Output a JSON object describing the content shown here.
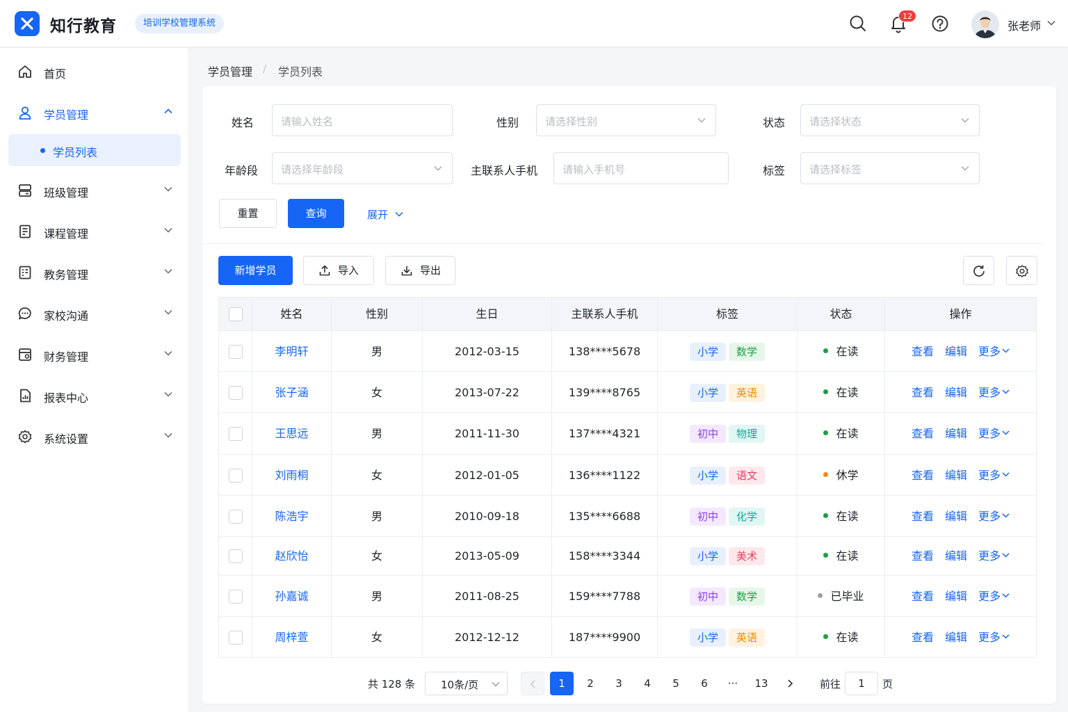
{
  "header": {
    "brand": "知行教育",
    "system_tag": "培训学校管理系统",
    "notification_count": "12",
    "user_name": "张老师"
  },
  "sidebar": {
    "items": [
      {
        "label": "首页",
        "icon": "home-icon"
      },
      {
        "label": "学员管理",
        "icon": "user-icon",
        "expanded": true
      },
      {
        "label": "班级管理",
        "icon": "class-icon"
      },
      {
        "label": "课程管理",
        "icon": "course-icon"
      },
      {
        "label": "教务管理",
        "icon": "academic-icon"
      },
      {
        "label": "家校沟通",
        "icon": "chat-icon"
      },
      {
        "label": "财务管理",
        "icon": "finance-icon"
      },
      {
        "label": "报表中心",
        "icon": "report-icon"
      },
      {
        "label": "系统设置",
        "icon": "gear-icon"
      }
    ],
    "sub_item": "学员列表"
  },
  "breadcrumb": [
    "学员管理",
    "学员列表"
  ],
  "filters": {
    "name_label": "姓名",
    "name_placeholder": "请输入姓名",
    "gender_label": "性别",
    "gender_placeholder": "请选择性别",
    "status_label": "状态",
    "status_placeholder": "请选择状态",
    "age_label": "年龄段",
    "age_placeholder": "请选择年龄段",
    "phone_label": "主联系人手机",
    "phone_placeholder": "请输入手机号",
    "tag_label": "标签",
    "tag_placeholder": "请选择标签",
    "reset": "重置",
    "query": "查询",
    "expand": "展开"
  },
  "toolbar": {
    "add": "新增学员",
    "import": "导入",
    "export": "导出"
  },
  "table": {
    "columns": [
      "姓名",
      "性别",
      "生日",
      "主联系人手机",
      "标签",
      "状态",
      "操作"
    ],
    "actions": [
      "查看",
      "编辑",
      "更多"
    ],
    "rows": [
      {
        "name": "李明轩",
        "gender": "男",
        "birthday": "2012-03-15",
        "phone": "138****5678",
        "tags": [
          "小学",
          "数学"
        ],
        "status": "在读"
      },
      {
        "name": "张子涵",
        "gender": "女",
        "birthday": "2013-07-22",
        "phone": "139****8765",
        "tags": [
          "小学",
          "英语"
        ],
        "status": "在读"
      },
      {
        "name": "王思远",
        "gender": "男",
        "birthday": "2011-11-30",
        "phone": "137****4321",
        "tags": [
          "初中",
          "物理"
        ],
        "status": "在读"
      },
      {
        "name": "刘雨桐",
        "gender": "女",
        "birthday": "2012-01-05",
        "phone": "136****1122",
        "tags": [
          "小学",
          "语文"
        ],
        "status": "休学"
      },
      {
        "name": "陈浩宇",
        "gender": "男",
        "birthday": "2010-09-18",
        "phone": "135****6688",
        "tags": [
          "初中",
          "化学"
        ],
        "status": "在读"
      },
      {
        "name": "赵欣怡",
        "gender": "女",
        "birthday": "2013-05-09",
        "phone": "158****3344",
        "tags": [
          "小学",
          "美术"
        ],
        "status": "在读"
      },
      {
        "name": "孙嘉诚",
        "gender": "男",
        "birthday": "2011-08-25",
        "phone": "159****7788",
        "tags": [
          "初中",
          "数学"
        ],
        "status": "已毕业"
      },
      {
        "name": "周梓萱",
        "gender": "女",
        "birthday": "2012-12-12",
        "phone": "187****9900",
        "tags": [
          "小学",
          "英语"
        ],
        "status": "在读"
      }
    ]
  },
  "tag_colors": {
    "小学": {
      "bg": "#e8f0fe",
      "fg": "#1665f5"
    },
    "初中": {
      "bg": "#f3e8fd",
      "fg": "#8a3ff0"
    },
    "数学": {
      "bg": "#e6f7ea",
      "fg": "#1f9d45"
    },
    "英语": {
      "bg": "#fff2e0",
      "fg": "#f08a00"
    },
    "物理": {
      "bg": "#e2f6f4",
      "fg": "#13a89e"
    },
    "语文": {
      "bg": "#fde8ec",
      "fg": "#e8405f"
    },
    "化学": {
      "bg": "#e2f6f4",
      "fg": "#13a89e"
    },
    "美术": {
      "bg": "#fde8ec",
      "fg": "#e8405f"
    }
  },
  "status_colors": {
    "在读": "#1f9d45",
    "休学": "#f08a00",
    "已毕业": "#9aa0a8"
  },
  "pagination": {
    "total": "共 128 条",
    "page_size": "10条/页",
    "pages": [
      "1",
      "2",
      "3",
      "4",
      "5",
      "6",
      "···",
      "13"
    ],
    "current": "1",
    "goto_label": "前往",
    "goto_value": "1",
    "page_suffix": "页"
  }
}
